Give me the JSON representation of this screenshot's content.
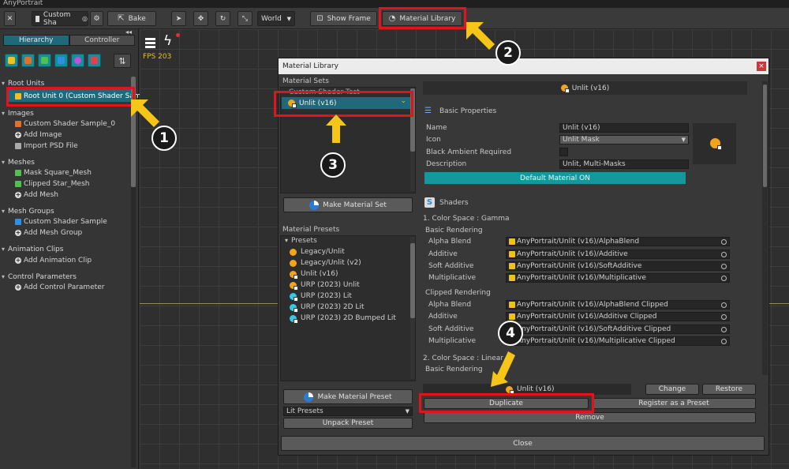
{
  "app": {
    "title": "AnyPortrait"
  },
  "toolbar": {
    "doc_name": "Custom Sha",
    "bake_label": "Bake",
    "space_value": "World",
    "show_frame_label": "Show Frame",
    "material_library_label": "Material Library"
  },
  "sidebar": {
    "tab_hierarchy": "Hierarchy",
    "tab_controller": "Controller",
    "sections": {
      "root_units": "Root Units",
      "root_unit_item": "Root Unit 0 (Custom Shader Samp",
      "images": "Images",
      "image_item": "Custom Shader Sample_0",
      "add_image": "Add Image",
      "import_psd": "Import PSD File",
      "meshes": "Meshes",
      "mesh_item_1": "Mask Square_Mesh",
      "mesh_item_2": "Clipped Star_Mesh",
      "add_mesh": "Add Mesh",
      "mesh_groups": "Mesh Groups",
      "mesh_group_item": "Custom Shader Sample",
      "add_mesh_group": "Add Mesh Group",
      "animation_clips": "Animation Clips",
      "add_animation_clip": "Add Animation Clip",
      "control_parameters": "Control Parameters",
      "add_control_parameter": "Add Control Parameter"
    }
  },
  "viewport": {
    "fps": "FPS 203"
  },
  "dialog": {
    "title": "Material Library",
    "material_sets_label": "Material Sets",
    "set_group": "Custom Shader Test",
    "selected_set": "Unlit (v16)",
    "make_material_set": "Make Material Set",
    "material_presets_label": "Material Presets",
    "presets_group": "Presets",
    "presets": [
      {
        "label": "Legacy/Unlit",
        "icon": "orange-dot"
      },
      {
        "label": "Legacy/Unlit (v2)",
        "icon": "orange-dot"
      },
      {
        "label": "Unlit (v16)",
        "icon": "unlit-icon"
      },
      {
        "label": "URP (2023) Unlit",
        "icon": "unlit-icon"
      },
      {
        "label": "URP (2023) Lit",
        "icon": "cyan-dot"
      },
      {
        "label": "URP (2023) 2D Lit",
        "icon": "cyan-dot"
      },
      {
        "label": "URP (2023) 2D Bumped Lit",
        "icon": "cyan-dot"
      }
    ],
    "make_material_preset": "Make Material Preset",
    "lit_presets": "Lit Presets",
    "unpack_preset": "Unpack Preset",
    "header_name": "Unlit (v16)",
    "basic_properties": "Basic Properties",
    "name_label": "Name",
    "name_value": "Unlit (v16)",
    "icon_label": "Icon",
    "icon_value": "Unlit Mask",
    "black_ambient_label": "Black Ambient Required",
    "description_label": "Description",
    "description_value": "Unlit, Multi-Masks",
    "default_material": "Default Material ON",
    "shaders": "Shaders",
    "color_space_gamma": "1. Color Space : Gamma",
    "basic_rendering": "Basic Rendering",
    "clipped_rendering": "Clipped Rendering",
    "color_space_linear": "2. Color Space : Linear",
    "basic_rendering_2": "Basic Rendering",
    "basic_rows": [
      {
        "label": "Alpha Blend",
        "value": "AnyPortrait/Unlit (v16)/AlphaBlend"
      },
      {
        "label": "Additive",
        "value": "AnyPortrait/Unlit (v16)/Additive"
      },
      {
        "label": "Soft Additive",
        "value": "AnyPortrait/Unlit (v16)/SoftAdditive"
      },
      {
        "label": "Multiplicative",
        "value": "AnyPortrait/Unlit (v16)/Multiplicative"
      }
    ],
    "clipped_rows": [
      {
        "label": "Alpha Blend",
        "value": "AnyPortrait/Unlit (v16)/AlphaBlend Clipped"
      },
      {
        "label": "Additive",
        "value": "AnyPortrait/Unlit (v16)/Additive Clipped"
      },
      {
        "label": "Soft Additive",
        "value": "AnyPortrait/Unlit (v16)/SoftAdditive Clipped"
      },
      {
        "label": "Multiplicative",
        "value": "AnyPortrait/Unlit (v16)/Multiplicative Clipped"
      }
    ],
    "footer_name": "Unlit (v16)",
    "change": "Change",
    "restore": "Restore",
    "duplicate": "Duplicate",
    "register_preset": "Register as a Preset",
    "remove": "Remove",
    "close": "Close"
  },
  "callouts": {
    "c1": "1",
    "c2": "2",
    "c3": "3",
    "c4": "4"
  },
  "colors": {
    "accent": "#1e6a7a",
    "highlight": "#e0141a",
    "arrow": "#f5c518"
  }
}
